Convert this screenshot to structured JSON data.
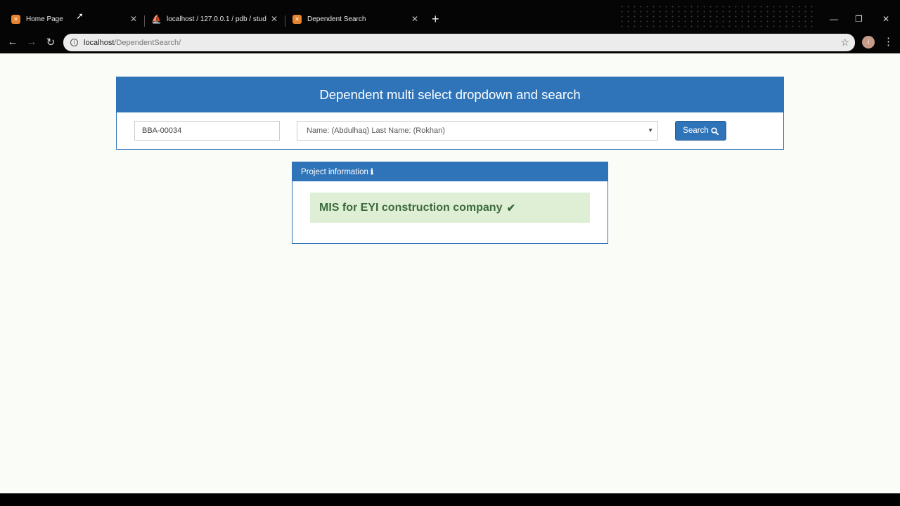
{
  "browser": {
    "tabs": [
      {
        "title": "Home Page",
        "favicon": "xampp-icon"
      },
      {
        "title": "localhost / 127.0.0.1 / pdb / stud",
        "favicon": "phpmyadmin-icon"
      },
      {
        "title": "Dependent Search",
        "favicon": "xampp-icon"
      }
    ],
    "url_host": "localhost",
    "url_path": "/DependentSearch/",
    "avatar_letter": "i"
  },
  "search_panel": {
    "title": "Dependent multi select dropdown and search",
    "id_value": "BBA-00034",
    "selected_name": "Name: (Abdulhaq) Last Name: (Rokhan)",
    "search_label": "Search"
  },
  "info_panel": {
    "title": "Project information",
    "project_name": "MIS for EYI construction company"
  },
  "colors": {
    "primary": "#2f74b9",
    "success_bg": "#deefd6",
    "success_text": "#3d6a3a"
  }
}
